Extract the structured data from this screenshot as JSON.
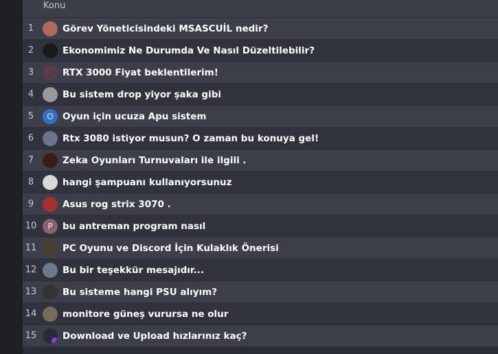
{
  "table": {
    "header": "Konu",
    "rows": [
      {
        "num": "1",
        "title": "Görev Yöneticisindeki MSASCUİL nedir?",
        "avatar": {
          "icon": "user-avatar-portrait-icon",
          "color": "#b06a5a",
          "letter": ""
        }
      },
      {
        "num": "2",
        "title": "Ekonomimiz Ne Durumda Ve Nasıl Düzeltilebilir?",
        "avatar": {
          "icon": "user-avatar-dark-icon",
          "color": "#1a1a1a",
          "letter": ""
        }
      },
      {
        "num": "3",
        "title": "RTX 3000 Fiyat beklentilerim!",
        "avatar": {
          "icon": "user-avatar-anime-icon",
          "color": "#5a3b4a",
          "letter": ""
        }
      },
      {
        "num": "4",
        "title": "Bu sistem drop yiyor şaka gibi",
        "avatar": {
          "icon": "user-avatar-moon-icon",
          "color": "#9a9a9a",
          "letter": ""
        }
      },
      {
        "num": "5",
        "title": "Oyun için ucuza Apu sistem",
        "avatar": {
          "icon": "user-avatar-letter-icon",
          "color": "#2f6fd0",
          "letter": "O"
        }
      },
      {
        "num": "6",
        "title": "Rtx 3080 istiyor musun? O zaman bu konuya gel!",
        "avatar": {
          "icon": "user-avatar-blue-icon",
          "color": "#6a7590",
          "letter": ""
        }
      },
      {
        "num": "7",
        "title": "Zeka Oyunları Turnuvaları ile ilgili .",
        "avatar": {
          "icon": "user-avatar-logo-icon",
          "color": "#3a1c12",
          "letter": ""
        }
      },
      {
        "num": "8",
        "title": "hangi şampuanı kullanıyorsunuz",
        "avatar": {
          "icon": "user-avatar-sketch-icon",
          "color": "#d8d8d8",
          "letter": ""
        }
      },
      {
        "num": "9",
        "title": "Asus rog strix 3070 .",
        "avatar": {
          "icon": "user-avatar-red-icon",
          "color": "#a8302a",
          "letter": ""
        }
      },
      {
        "num": "10",
        "title": "bu antreman program nasıl",
        "avatar": {
          "icon": "user-avatar-letter-icon",
          "color": "#8c5f6a",
          "letter": "P"
        }
      },
      {
        "num": "11",
        "title": "PC Oyunu ve Discord İçin Kulaklık Önerisi",
        "avatar": {
          "icon": "user-avatar-hat-icon",
          "color": "#4a3e2c",
          "letter": ""
        }
      },
      {
        "num": "12",
        "title": "Bu bir teşekkür mesajıdır...",
        "avatar": {
          "icon": "user-avatar-photo-icon",
          "color": "#6a7a8a",
          "letter": ""
        }
      },
      {
        "num": "13",
        "title": "Bu sisteme hangi PSU alıyım?",
        "avatar": {
          "icon": "user-avatar-badge-icon",
          "color": "#333333",
          "letter": ""
        }
      },
      {
        "num": "14",
        "title": "monitore güneş vurursa ne olur",
        "avatar": {
          "icon": "user-avatar-face-icon",
          "color": "#7a6a5a",
          "letter": ""
        }
      },
      {
        "num": "15",
        "title": "Download ve Upload hızlarınız kaç?",
        "avatar": {
          "icon": "user-avatar-hood-icon",
          "color": "#2a2a35",
          "letter": "",
          "badge": true
        }
      }
    ]
  }
}
